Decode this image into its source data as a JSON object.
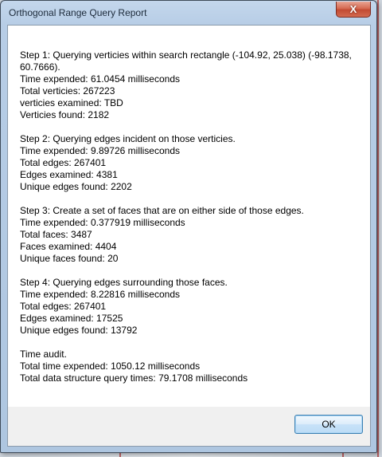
{
  "window": {
    "title": "Orthogonal Range Query Report",
    "close_glyph": "X"
  },
  "report": {
    "sections": [
      [
        "Step 1: Querying verticies within search rectangle (-104.92, 25.038) (-98.1738, 60.7666).",
        "Time expended: 61.0454 milliseconds",
        "Total verticies: 267223",
        "verticies examined: TBD",
        "Verticies found: 2182"
      ],
      [
        "Step 2: Querying edges incident on those verticies.",
        "Time expended: 9.89726 milliseconds",
        "Total edges: 267401",
        "Edges examined: 4381",
        "Unique edges found: 2202"
      ],
      [
        "Step 3: Create a set of faces that are on either side of those edges.",
        "Time expended: 0.377919 milliseconds",
        "Total faces: 3487",
        "Faces examined: 4404",
        "Unique faces found: 20"
      ],
      [
        "Step 4: Querying edges surrounding those faces.",
        "Time expended: 8.22816 milliseconds",
        "Total edges: 267401",
        "Edges examined: 17525",
        "Unique edges found: 13792"
      ],
      [
        "Time audit.",
        "Total time expended: 1050.12 milliseconds",
        "Total data structure query times: 79.1708 milliseconds"
      ]
    ]
  },
  "buttons": {
    "ok_label": "OK"
  }
}
